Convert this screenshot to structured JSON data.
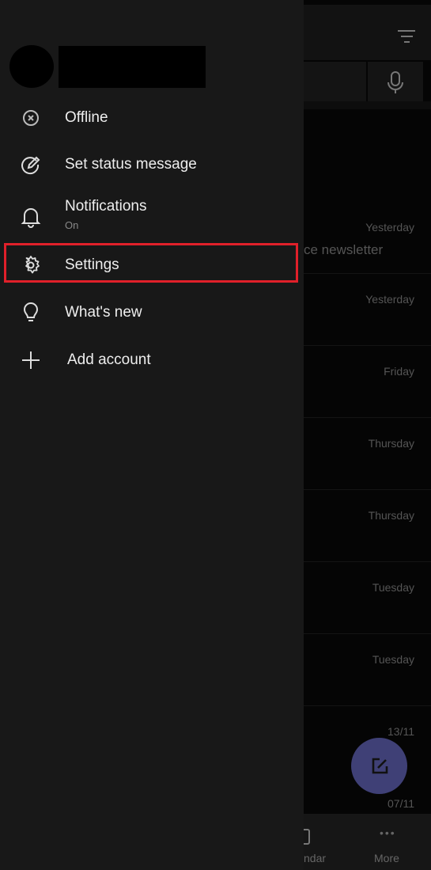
{
  "drawer": {
    "items": [
      {
        "label": "Offline",
        "icon": "offline-x-circle-icon"
      },
      {
        "label": "Set status message",
        "icon": "edit-status-icon"
      },
      {
        "label": "Notifications",
        "sublabel": "On",
        "icon": "bell-icon"
      },
      {
        "label": "Settings",
        "icon": "gear-icon"
      },
      {
        "label": "What's new",
        "icon": "lightbulb-icon"
      },
      {
        "label": "Add account",
        "icon": "plus-icon"
      }
    ]
  },
  "background": {
    "snippet": "ce newsletter",
    "timestamps": [
      "Yesterday",
      "Yesterday",
      "Friday",
      "Thursday",
      "Thursday",
      "Tuesday",
      "Tuesday",
      "13/11",
      "07/11"
    ],
    "nav": {
      "calendar": "ndar",
      "more": "More"
    }
  },
  "colors": {
    "highlight": "#e0202a",
    "fab": "#3f4076",
    "drawer": "#181818"
  }
}
